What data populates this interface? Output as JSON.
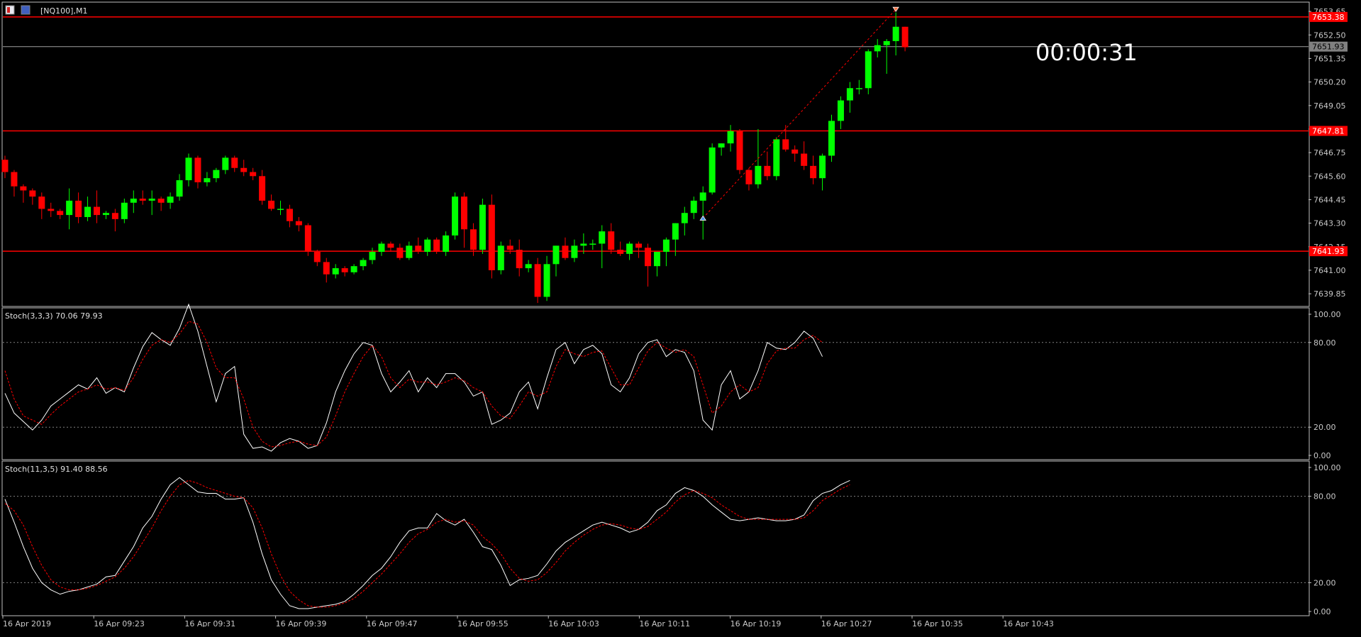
{
  "window": {
    "symbol_label": "[NQ100],M1",
    "countdown": "00:00:31"
  },
  "colors": {
    "background": "#000000",
    "bull": "#00ff00",
    "bear": "#ff0000",
    "outline_bull": "#00ff00",
    "outline_bear": "#ff0000",
    "hline": "#ff0000",
    "grid_dotted": "#808080",
    "axis_text": "#c8c8c8",
    "stoch_main": "#ffffff",
    "stoch_signal": "#ff0000",
    "bid_line": "#a0a0a0",
    "tag_red_bg": "#ff0000",
    "tag_gray_bg": "#808080"
  },
  "price_pane": {
    "y_axis_ticks": [
      "7653.65",
      "7652.50",
      "7651.35",
      "7650.20",
      "7649.05",
      "7647.90",
      "7646.75",
      "7645.60",
      "7644.45",
      "7643.30",
      "7642.15",
      "7641.00",
      "7639.85"
    ],
    "ylim": [
      7639.3,
      7654.0
    ],
    "hlines": [
      {
        "price": 7653.38,
        "label": "7653.38"
      },
      {
        "price": 7647.81,
        "label": "7647.81"
      },
      {
        "price": 7641.93,
        "label": "7641.93"
      }
    ],
    "bid": {
      "price": 7651.93,
      "label": "7651.93"
    }
  },
  "x_axis_labels": [
    "16 Apr 2019",
    "16 Apr 09:23",
    "16 Apr 09:31",
    "16 Apr 09:39",
    "16 Apr 09:47",
    "16 Apr 09:55",
    "16 Apr 10:03",
    "16 Apr 10:11",
    "16 Apr 10:19",
    "16 Apr 10:27",
    "16 Apr 10:35",
    "16 Apr 10:43"
  ],
  "chart_data": [
    {
      "type": "candlestick",
      "title": "[NQ100],M1",
      "ohlc": [
        [
          7646.4,
          7646.6,
          7645.5,
          7645.8
        ],
        [
          7645.8,
          7645.9,
          7644.6,
          7645.1
        ],
        [
          7645.1,
          7645.2,
          7644.3,
          7644.9
        ],
        [
          7644.9,
          7645.0,
          7644.2,
          7644.6
        ],
        [
          7644.6,
          7644.8,
          7643.5,
          7644.0
        ],
        [
          7644.0,
          7644.3,
          7643.6,
          7643.9
        ],
        [
          7643.9,
          7644.0,
          7643.5,
          7643.7
        ],
        [
          7643.7,
          7645.0,
          7643.0,
          7644.4
        ],
        [
          7644.4,
          7644.8,
          7643.3,
          7643.6
        ],
        [
          7643.6,
          7644.6,
          7643.4,
          7644.1
        ],
        [
          7644.1,
          7644.9,
          7643.3,
          7643.7
        ],
        [
          7643.7,
          7643.9,
          7643.5,
          7643.8
        ],
        [
          7643.8,
          7644.0,
          7642.9,
          7643.5
        ],
        [
          7643.5,
          7644.5,
          7643.3,
          7644.3
        ],
        [
          7644.3,
          7644.9,
          7643.8,
          7644.5
        ],
        [
          7644.5,
          7644.9,
          7644.2,
          7644.4
        ],
        [
          7644.4,
          7644.9,
          7643.7,
          7644.5
        ],
        [
          7644.5,
          7644.6,
          7643.9,
          7644.3
        ],
        [
          7644.3,
          7644.8,
          7644.0,
          7644.6
        ],
        [
          7644.6,
          7645.7,
          7644.4,
          7645.4
        ],
        [
          7645.4,
          7646.7,
          7645.1,
          7646.5
        ],
        [
          7646.5,
          7646.6,
          7645.0,
          7645.3
        ],
        [
          7645.3,
          7645.8,
          7645.1,
          7645.5
        ],
        [
          7645.5,
          7646.0,
          7645.3,
          7645.9
        ],
        [
          7645.9,
          7646.6,
          7645.7,
          7646.5
        ],
        [
          7646.5,
          7646.6,
          7645.8,
          7646.0
        ],
        [
          7646.0,
          7646.4,
          7645.6,
          7645.8
        ],
        [
          7645.8,
          7646.0,
          7645.4,
          7645.6
        ],
        [
          7645.6,
          7645.9,
          7644.2,
          7644.4
        ],
        [
          7644.4,
          7644.7,
          7643.9,
          7644.0
        ],
        [
          7644.0,
          7644.4,
          7643.7,
          7644.0
        ],
        [
          7644.0,
          7644.2,
          7643.1,
          7643.4
        ],
        [
          7643.4,
          7643.6,
          7642.9,
          7643.2
        ],
        [
          7643.2,
          7643.3,
          7641.7,
          7641.9
        ],
        [
          7641.9,
          7642.0,
          7641.2,
          7641.4
        ],
        [
          7641.4,
          7641.6,
          7640.4,
          7640.8
        ],
        [
          7640.8,
          7641.3,
          7640.6,
          7641.1
        ],
        [
          7641.1,
          7641.2,
          7640.7,
          7640.9
        ],
        [
          7640.9,
          7641.3,
          7640.8,
          7641.2
        ],
        [
          7641.2,
          7641.6,
          7641.0,
          7641.5
        ],
        [
          7641.5,
          7642.1,
          7641.3,
          7641.9
        ],
        [
          7641.9,
          7642.4,
          7641.7,
          7642.3
        ],
        [
          7642.3,
          7642.4,
          7641.9,
          7642.1
        ],
        [
          7642.1,
          7642.3,
          7641.5,
          7641.6
        ],
        [
          7641.6,
          7642.4,
          7641.5,
          7642.2
        ],
        [
          7642.2,
          7642.6,
          7641.8,
          7641.9
        ],
        [
          7641.9,
          7642.6,
          7641.7,
          7642.5
        ],
        [
          7642.5,
          7642.6,
          7641.8,
          7641.9
        ],
        [
          7641.9,
          7642.9,
          7641.7,
          7642.7
        ],
        [
          7642.7,
          7644.8,
          7642.5,
          7644.6
        ],
        [
          7644.6,
          7644.8,
          7642.1,
          7643.0
        ],
        [
          7643.0,
          7643.3,
          7641.7,
          7642.0
        ],
        [
          7642.0,
          7644.5,
          7641.8,
          7644.2
        ],
        [
          7644.2,
          7644.7,
          7640.6,
          7641.0
        ],
        [
          7641.0,
          7642.4,
          7640.8,
          7642.2
        ],
        [
          7642.2,
          7642.5,
          7641.8,
          7642.0
        ],
        [
          7642.0,
          7642.5,
          7640.7,
          7641.1
        ],
        [
          7641.1,
          7641.5,
          7640.9,
          7641.3
        ],
        [
          7641.3,
          7641.6,
          7639.4,
          7639.7
        ],
        [
          7639.7,
          7641.7,
          7639.5,
          7641.3
        ],
        [
          7641.3,
          7642.2,
          7640.7,
          7642.2
        ],
        [
          7642.2,
          7642.6,
          7641.5,
          7641.6
        ],
        [
          7641.6,
          7642.5,
          7641.4,
          7642.2
        ],
        [
          7642.2,
          7642.8,
          7641.8,
          7642.3
        ],
        [
          7642.3,
          7642.5,
          7642.0,
          7642.3
        ],
        [
          7642.3,
          7643.2,
          7641.1,
          7642.9
        ],
        [
          7642.9,
          7643.3,
          7641.8,
          7642.0
        ],
        [
          7642.0,
          7642.4,
          7641.7,
          7641.8
        ],
        [
          7641.8,
          7642.4,
          7641.5,
          7642.3
        ],
        [
          7642.3,
          7642.4,
          7641.6,
          7642.1
        ],
        [
          7642.1,
          7642.3,
          7640.2,
          7641.2
        ],
        [
          7641.2,
          7641.9,
          7640.7,
          7641.9
        ],
        [
          7641.9,
          7642.6,
          7641.2,
          7642.5
        ],
        [
          7642.5,
          7643.3,
          7641.7,
          7643.3
        ],
        [
          7643.3,
          7644.1,
          7642.7,
          7643.8
        ],
        [
          7643.8,
          7644.6,
          7643.5,
          7644.4
        ],
        [
          7644.4,
          7645.1,
          7642.5,
          7644.8
        ],
        [
          7644.8,
          7647.2,
          7644.7,
          7647.0
        ],
        [
          7647.0,
          7647.2,
          7646.6,
          7647.2
        ],
        [
          7647.2,
          7648.1,
          7646.8,
          7647.8
        ],
        [
          7647.8,
          7647.9,
          7645.7,
          7645.9
        ],
        [
          7645.9,
          7646.0,
          7644.9,
          7645.2
        ],
        [
          7645.2,
          7647.9,
          7645.0,
          7646.1
        ],
        [
          7646.1,
          7646.8,
          7645.4,
          7645.6
        ],
        [
          7645.6,
          7647.5,
          7645.4,
          7647.4
        ],
        [
          7647.4,
          7648.1,
          7646.8,
          7646.9
        ],
        [
          7646.9,
          7647.1,
          7646.3,
          7646.7
        ],
        [
          7646.7,
          7647.3,
          7645.9,
          7646.1
        ],
        [
          7646.1,
          7646.6,
          7645.2,
          7645.5
        ],
        [
          7645.5,
          7646.7,
          7644.9,
          7646.6
        ],
        [
          7646.6,
          7648.6,
          7646.3,
          7648.3
        ],
        [
          7648.3,
          7649.5,
          7647.9,
          7649.3
        ],
        [
          7649.3,
          7650.2,
          7648.7,
          7649.9
        ],
        [
          7649.9,
          7650.3,
          7649.6,
          7649.9
        ],
        [
          7649.9,
          7651.8,
          7649.6,
          7651.7
        ],
        [
          7651.7,
          7652.3,
          7651.4,
          7652.0
        ],
        [
          7652.0,
          7652.3,
          7650.6,
          7652.2
        ],
        [
          7652.2,
          7653.6,
          7651.5,
          7652.9
        ],
        [
          7652.9,
          7652.9,
          7651.7,
          7651.9
        ]
      ],
      "markers": [
        {
          "bar": 76,
          "price": 7643.55,
          "kind": "up-arrow"
        },
        {
          "bar": 97,
          "price": 7653.75,
          "kind": "down-arrow"
        }
      ],
      "trend_line": {
        "from_bar": 76,
        "from_price": 7643.55,
        "to_bar": 97,
        "to_price": 7653.75
      }
    },
    {
      "type": "line",
      "title": "Stoch(3,3,3) 70.06 79.93",
      "ylim": [
        0,
        100
      ],
      "levels": [
        20,
        80
      ],
      "y_axis_ticks": [
        "100.00",
        "80.00",
        "20.00",
        "0.00"
      ],
      "series": [
        {
          "name": "main",
          "values": [
            44,
            30,
            24,
            18,
            25,
            35,
            40,
            45,
            50,
            47,
            55,
            44,
            48,
            45,
            62,
            77,
            87,
            82,
            78,
            90,
            107,
            88,
            63,
            38,
            58,
            63,
            15,
            5,
            6,
            3,
            9,
            12,
            10,
            5,
            7,
            23,
            45,
            60,
            72,
            80,
            78,
            58,
            45,
            52,
            60,
            45,
            55,
            48,
            58,
            58,
            52,
            42,
            45,
            22,
            25,
            30,
            45,
            52,
            33,
            55,
            75,
            80,
            65,
            75,
            78,
            72,
            50,
            45,
            55,
            72,
            80,
            82,
            70,
            75,
            73,
            60,
            25,
            18,
            50,
            60,
            40,
            45,
            60,
            80,
            76,
            75,
            80,
            88,
            83,
            70
          ]
        },
        {
          "name": "signal",
          "values": [
            60,
            40,
            28,
            25,
            22,
            29,
            35,
            40,
            45,
            47,
            50,
            47,
            48,
            46,
            55,
            68,
            78,
            82,
            80,
            86,
            95,
            93,
            80,
            62,
            55,
            55,
            40,
            20,
            10,
            6,
            7,
            9,
            10,
            8,
            7,
            13,
            28,
            45,
            58,
            70,
            78,
            70,
            55,
            48,
            54,
            52,
            52,
            50,
            52,
            55,
            53,
            48,
            45,
            35,
            28,
            26,
            35,
            45,
            42,
            45,
            63,
            75,
            72,
            70,
            73,
            74,
            62,
            50,
            50,
            62,
            74,
            80,
            76,
            73,
            75,
            70,
            50,
            30,
            35,
            45,
            50,
            45,
            48,
            65,
            74,
            76,
            76,
            82,
            85,
            80
          ]
        }
      ]
    },
    {
      "type": "line",
      "title": "Stoch(11,3,5) 91.40 88.56",
      "ylim": [
        0,
        100
      ],
      "levels": [
        20,
        80
      ],
      "y_axis_ticks": [
        "100.00",
        "80.00",
        "20.00",
        "0.00"
      ],
      "series": [
        {
          "name": "main",
          "values": [
            78,
            62,
            45,
            30,
            20,
            15,
            12,
            14,
            15,
            17,
            19,
            24,
            25,
            35,
            45,
            58,
            66,
            78,
            88,
            93,
            88,
            83,
            82,
            82,
            78,
            78,
            79,
            62,
            40,
            22,
            12,
            4,
            2,
            2,
            3,
            4,
            5,
            7,
            12,
            18,
            25,
            30,
            38,
            48,
            56,
            58,
            58,
            68,
            63,
            60,
            64,
            55,
            45,
            43,
            32,
            18,
            22,
            23,
            25,
            33,
            42,
            48,
            52,
            56,
            60,
            62,
            60,
            58,
            55,
            57,
            62,
            70,
            74,
            82,
            86,
            84,
            80,
            74,
            69,
            64,
            63,
            64,
            65,
            64,
            63,
            63,
            64,
            67,
            77,
            82,
            84,
            88,
            91
          ]
        },
        {
          "name": "signal",
          "values": [
            75,
            70,
            60,
            45,
            32,
            22,
            17,
            15,
            15,
            16,
            18,
            21,
            24,
            30,
            38,
            48,
            58,
            70,
            80,
            88,
            91,
            89,
            86,
            84,
            82,
            80,
            79,
            72,
            58,
            40,
            25,
            14,
            8,
            4,
            3,
            3,
            4,
            6,
            9,
            14,
            20,
            26,
            33,
            40,
            48,
            54,
            57,
            62,
            64,
            62,
            63,
            60,
            52,
            47,
            40,
            30,
            23,
            21,
            22,
            27,
            34,
            42,
            48,
            53,
            57,
            60,
            61,
            60,
            58,
            57,
            59,
            64,
            69,
            76,
            81,
            84,
            82,
            79,
            74,
            70,
            66,
            64,
            64,
            64,
            64,
            64,
            64,
            65,
            70,
            77,
            81,
            85,
            88
          ]
        }
      ]
    }
  ]
}
